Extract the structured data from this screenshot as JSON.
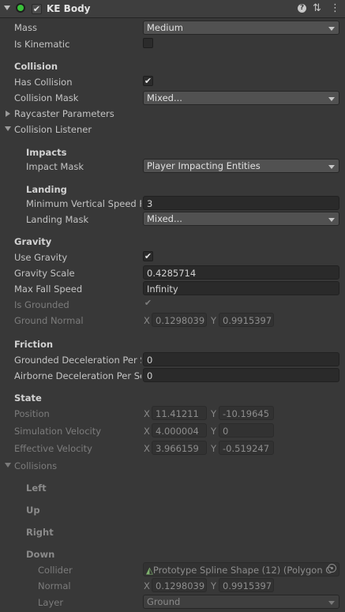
{
  "component": {
    "title": "KE Body",
    "enabled_check": "✔",
    "icons": {
      "status": "green-dot-icon",
      "help": "help-icon",
      "presets": "presets-icon",
      "menu": "kebab-menu-icon"
    },
    "colors": {
      "status": "#39c23a",
      "background": "#383838",
      "field": "#2a2a2a"
    }
  },
  "rows": {
    "mass": {
      "label": "Mass",
      "value": "Medium"
    },
    "is_kinematic": {
      "label": "Is Kinematic"
    },
    "collision_header": "Collision",
    "has_collision": {
      "label": "Has Collision",
      "check": "✔"
    },
    "collision_mask": {
      "label": "Collision Mask",
      "value": "Mixed..."
    },
    "raycaster": {
      "label": "Raycaster Parameters"
    },
    "listener": {
      "label": "Collision Listener"
    },
    "impacts_header": "Impacts",
    "impact_mask": {
      "label": "Impact Mask",
      "value": "Player Impacting Entities"
    },
    "landing_header": "Landing",
    "min_vertical_speed": {
      "label": "Minimum Vertical Speed F",
      "value": "3"
    },
    "landing_mask": {
      "label": "Landing Mask",
      "value": "Mixed..."
    },
    "gravity_header": "Gravity",
    "use_gravity": {
      "label": "Use Gravity",
      "check": "✔"
    },
    "gravity_scale": {
      "label": "Gravity Scale",
      "value": "0.4285714"
    },
    "max_fall_speed": {
      "label": "Max Fall Speed",
      "value": "Infinity"
    },
    "is_grounded": {
      "label": "Is Grounded",
      "check": "✔"
    },
    "ground_normal": {
      "label": "Ground Normal",
      "x": "0.1298039",
      "y": "0.9915397"
    },
    "friction_header": "Friction",
    "grounded_decel": {
      "label": "Grounded Deceleration Per S",
      "value": "0"
    },
    "airborne_decel": {
      "label": "Airborne Deceleration Per Se",
      "value": "0"
    },
    "state_header": "State",
    "position": {
      "label": "Position",
      "x": "11.41211",
      "y": "-10.19645"
    },
    "sim_velocity": {
      "label": "Simulation Velocity",
      "x": "4.000004",
      "y": "0"
    },
    "eff_velocity": {
      "label": "Effective Velocity",
      "x": "3.966159",
      "y": "-0.519247"
    },
    "collisions": {
      "label": "Collisions"
    },
    "left_header": "Left",
    "up_header": "Up",
    "right_header": "Right",
    "down_header": "Down",
    "collider": {
      "label": "Collider",
      "value": "Prototype Spline Shape (12) (Polygon C"
    },
    "normal": {
      "label": "Normal",
      "x": "0.1298039",
      "y": "0.9915397"
    },
    "layer": {
      "label": "Layer",
      "value": "Ground"
    }
  },
  "axis": {
    "x": "X",
    "y": "Y"
  }
}
